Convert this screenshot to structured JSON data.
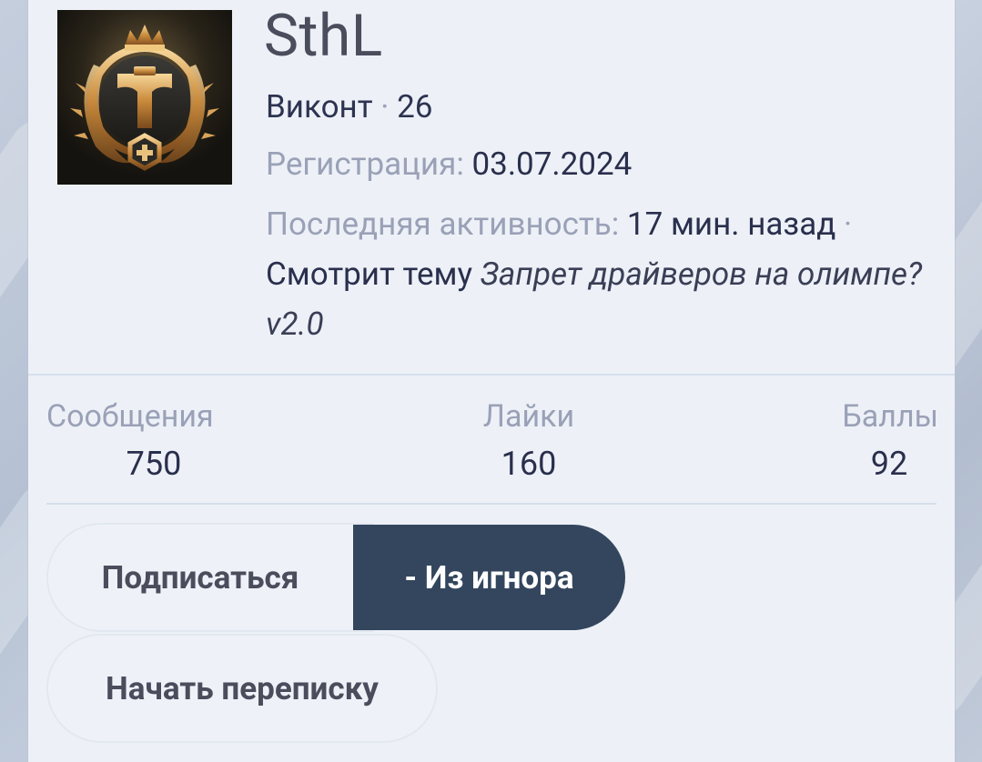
{
  "profile": {
    "username": "SthL",
    "rank": "Виконт",
    "separator": " · ",
    "level": "26",
    "registration_label": "Регистрация:",
    "registration_date": "03.07.2024",
    "last_activity_label": "Последняя активность:",
    "last_activity_value": "17 мин. назад",
    "activity_separator": " ·",
    "activity_action": "Смотрит тему",
    "activity_thread": "Запрет драйверов на олимпе? v2.0"
  },
  "stats": [
    {
      "label": "Сообщения",
      "value": "750"
    },
    {
      "label": "Лайки",
      "value": "160"
    },
    {
      "label": "Баллы",
      "value": "92"
    }
  ],
  "actions": {
    "subscribe": "Подписаться",
    "unignore": "- Из игнора",
    "start_conversation": "Начать переписку"
  },
  "colors": {
    "accent_button": "#33465e",
    "card_background": "#edf1f7",
    "muted_text": "#9aa1b7",
    "primary_text": "#2a2f4d"
  },
  "icons": {
    "avatar": "gold-crown-emblem-avatar"
  }
}
